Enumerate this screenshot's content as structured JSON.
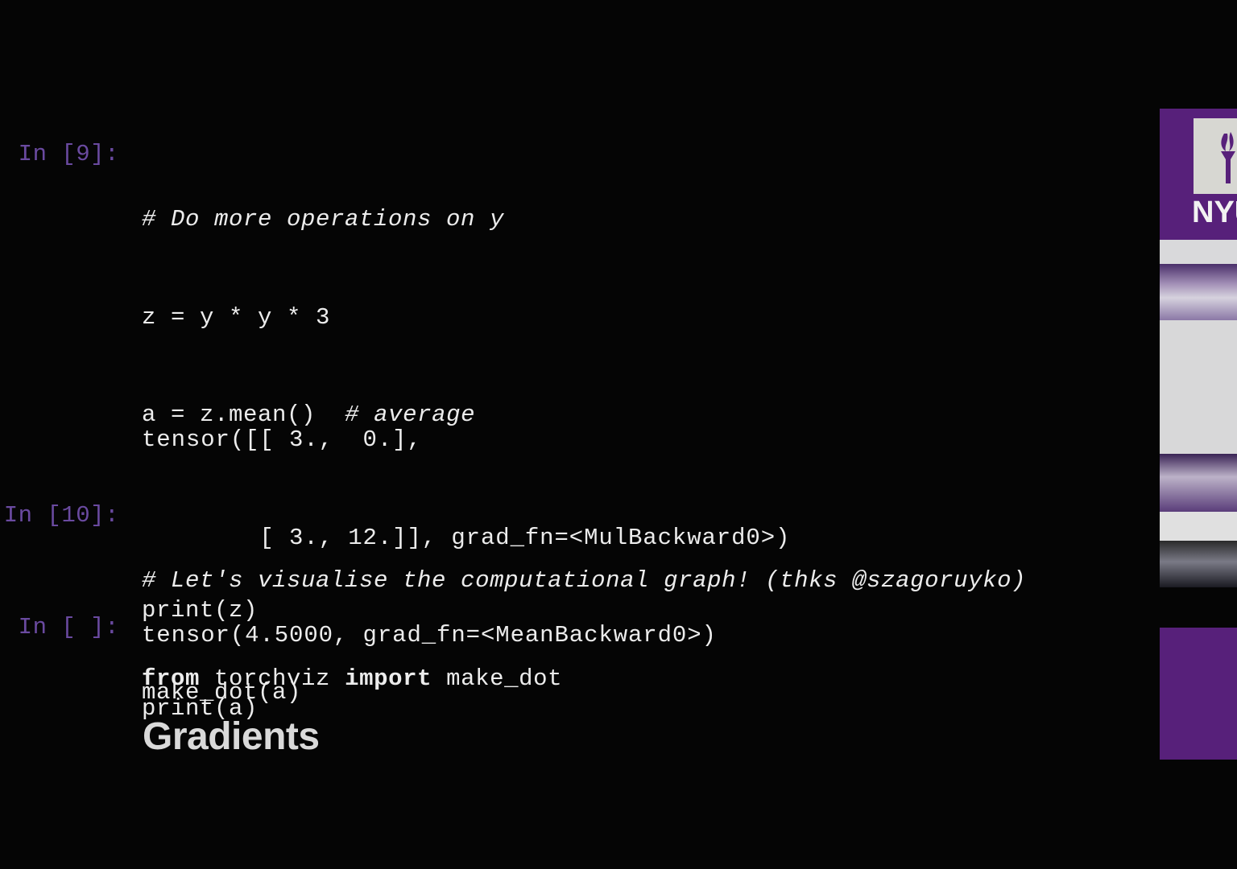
{
  "cells": [
    {
      "prompt": "In [9]:",
      "code": [
        "# Do more operations on y",
        "z = y * y * 3",
        "a = z.mean()",
        "# average",
        "print(z)",
        "print(a)"
      ],
      "output": [
        "tensor([[ 3.,  0.],",
        "        [ 3., 12.]], grad_fn=<MulBackward0>)",
        "tensor(4.5000, grad_fn=<MeanBackward0>)"
      ]
    },
    {
      "prompt": "In [10]:",
      "code": [
        "# Let's visualise the computational graph! (thks @szagoruyko)",
        "from",
        "torchviz",
        "import",
        "make_dot"
      ]
    },
    {
      "prompt": "In [ ]:",
      "code": [
        "make_dot(a)"
      ]
    }
  ],
  "markdown": {
    "heading": "Gradients"
  },
  "side_panel": {
    "logo_text": "NYU",
    "brand_color": "#57207a",
    "logo_icon": "torch-icon"
  }
}
